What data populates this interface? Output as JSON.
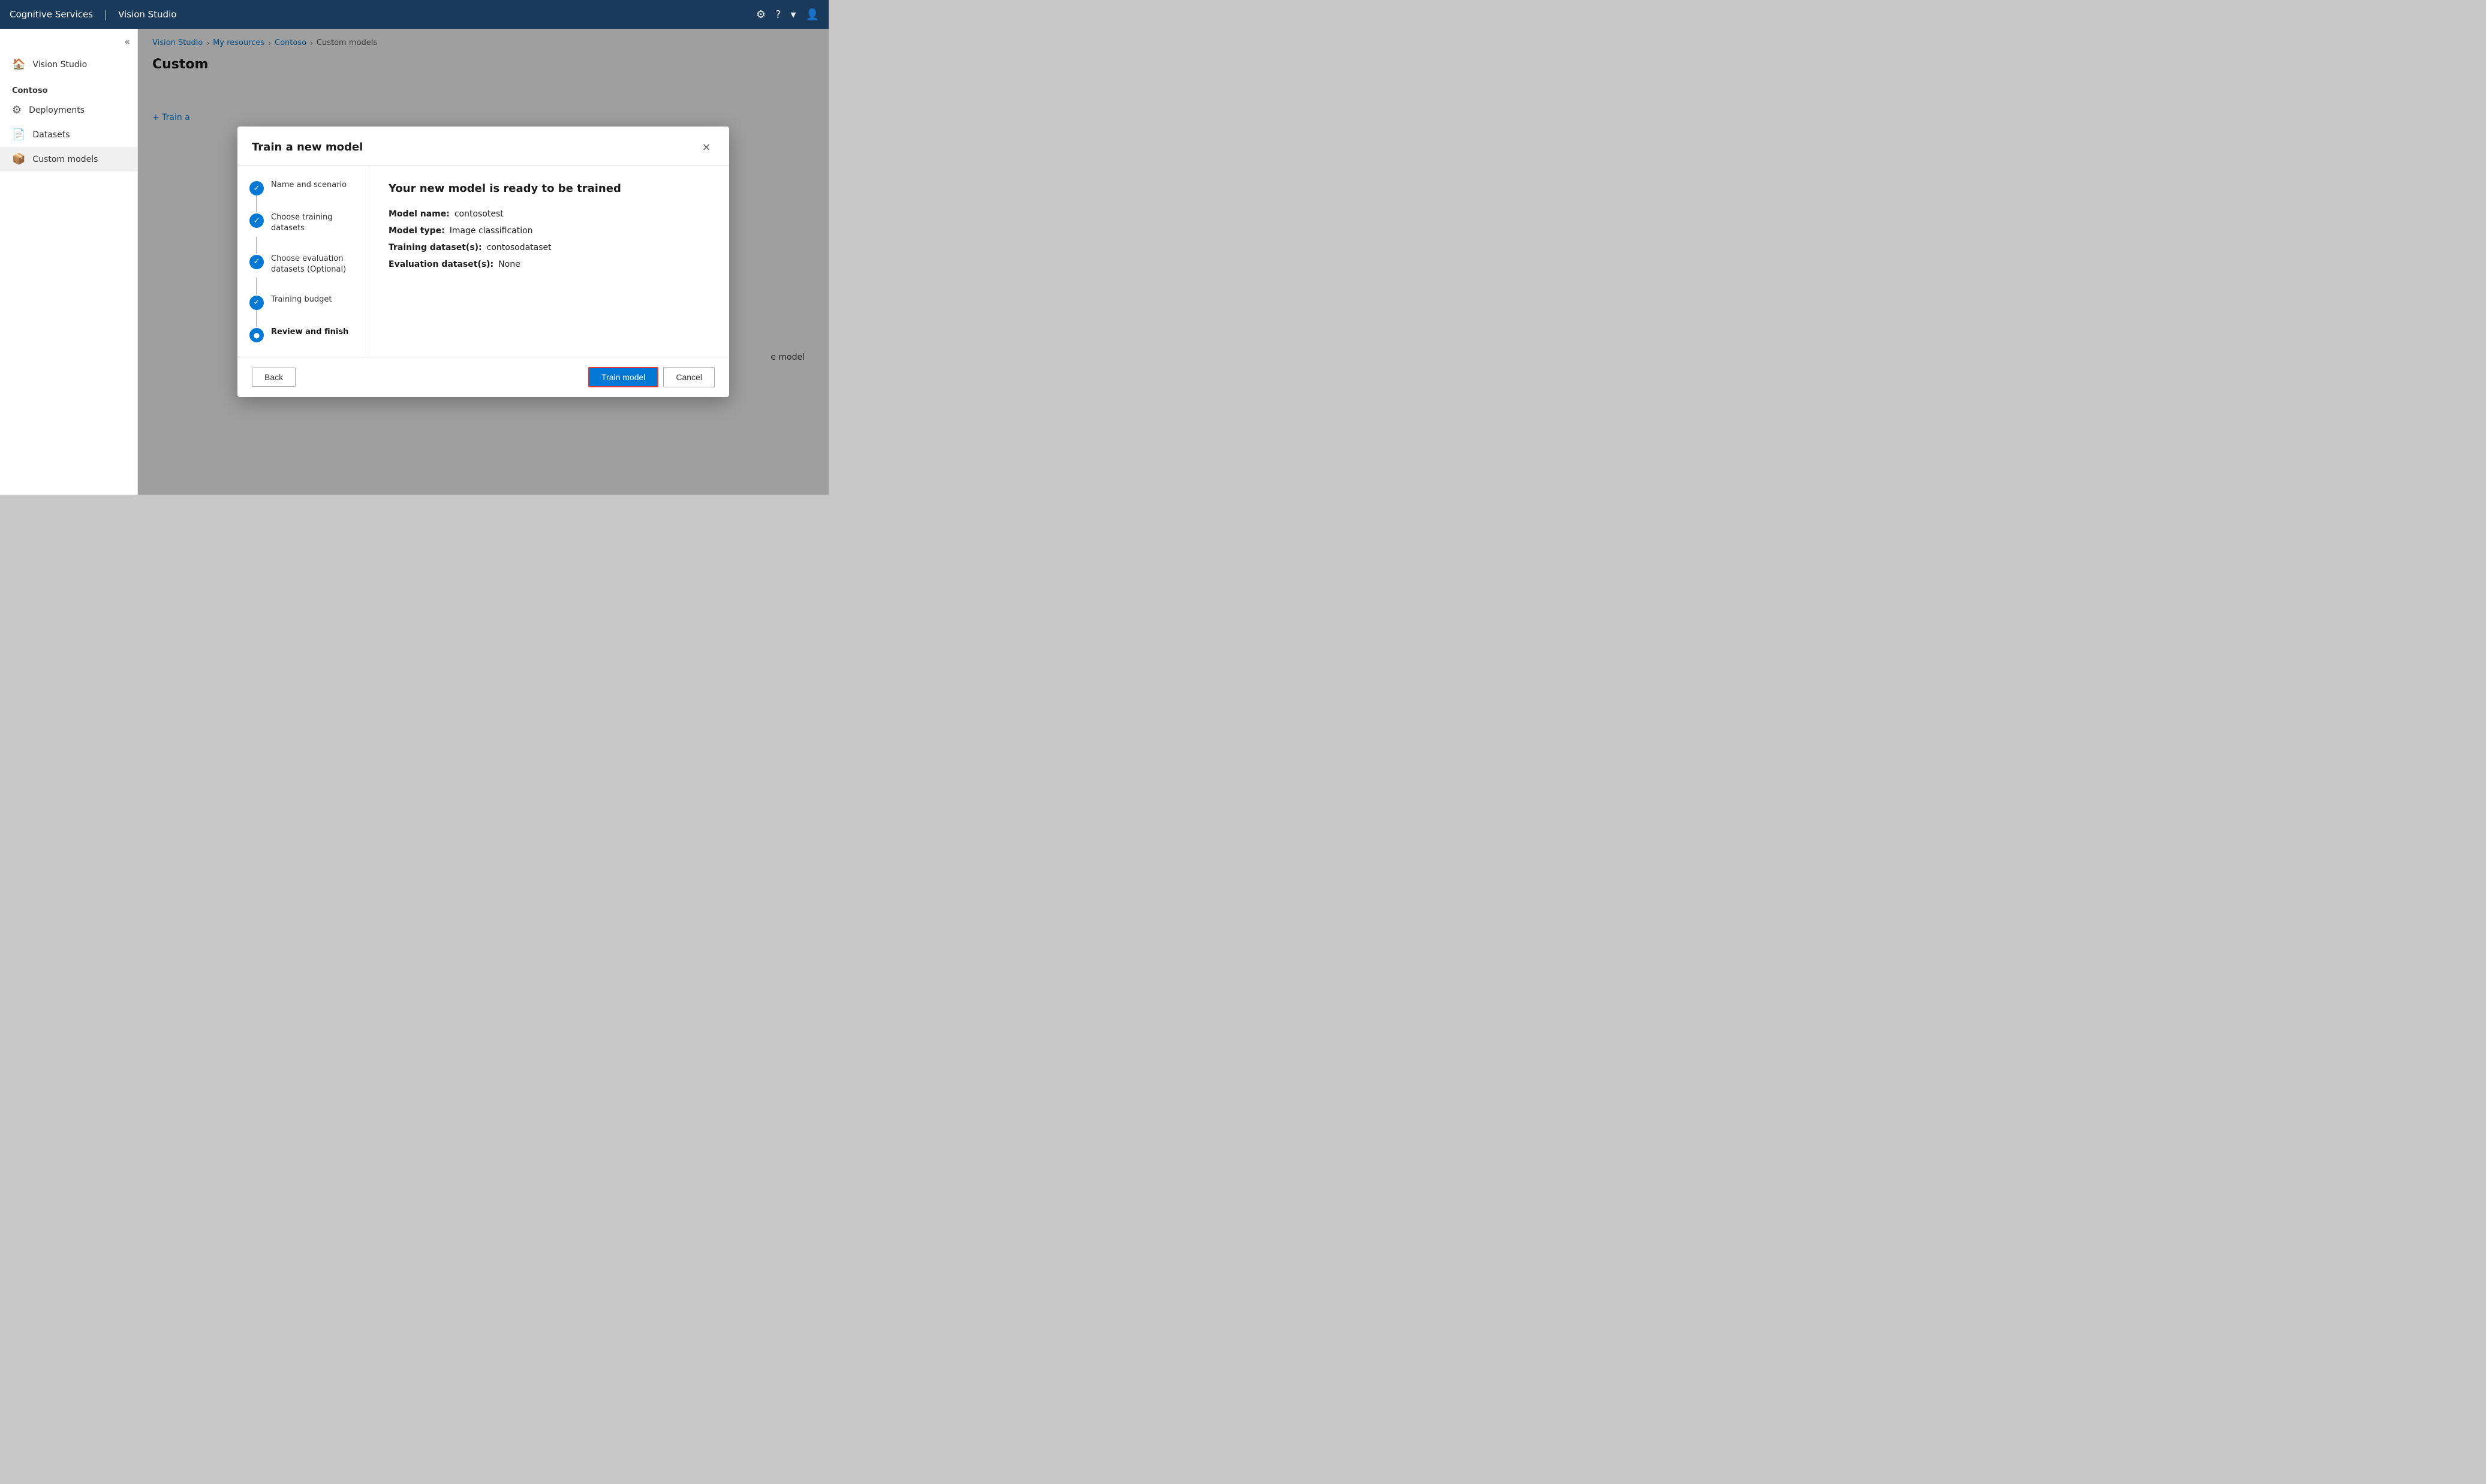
{
  "app": {
    "brand": "Cognitive Services",
    "separator": "|",
    "product": "Vision Studio"
  },
  "topNav": {
    "settingsIcon": "⚙",
    "helpIcon": "?",
    "caretIcon": "▾",
    "accountIcon": "👤"
  },
  "sidebar": {
    "collapseIcon": "«",
    "navItems": [
      {
        "id": "vision-studio",
        "label": "Vision Studio",
        "icon": "🏠"
      },
      {
        "id": "deployments",
        "label": "Deployments",
        "icon": "⚙"
      },
      {
        "id": "datasets",
        "label": "Datasets",
        "icon": "📄"
      },
      {
        "id": "custom-models",
        "label": "Custom models",
        "icon": "📦",
        "active": true
      }
    ],
    "sectionTitle": "Contoso"
  },
  "breadcrumb": {
    "items": [
      {
        "label": "Vision Studio",
        "current": false
      },
      {
        "label": "My resources",
        "current": false
      },
      {
        "label": "Contoso",
        "current": false
      },
      {
        "label": "Custom models",
        "current": true
      }
    ]
  },
  "pageTitle": "Custom",
  "backgroundTrainButton": "+ Train a",
  "backgroundRightText": "e model",
  "modal": {
    "title": "Train a new model",
    "closeIcon": "×",
    "steps": [
      {
        "id": "name-scenario",
        "label": "Name and scenario",
        "state": "completed"
      },
      {
        "id": "training-datasets",
        "label": "Choose training datasets",
        "state": "completed"
      },
      {
        "id": "evaluation-datasets",
        "label": "Choose evaluation datasets (Optional)",
        "state": "completed"
      },
      {
        "id": "training-budget",
        "label": "Training budget",
        "state": "completed"
      },
      {
        "id": "review-finish",
        "label": "Review and finish",
        "state": "active"
      }
    ],
    "content": {
      "title": "Your new model is ready to be trained",
      "fields": [
        {
          "label": "Model name:",
          "value": "contosotest"
        },
        {
          "label": "Model type:",
          "value": "Image classification"
        },
        {
          "label": "Training dataset(s):",
          "value": "contosodataset"
        },
        {
          "label": "Evaluation dataset(s):",
          "value": "None"
        }
      ]
    },
    "footer": {
      "backLabel": "Back",
      "trainLabel": "Train model",
      "cancelLabel": "Cancel"
    }
  }
}
